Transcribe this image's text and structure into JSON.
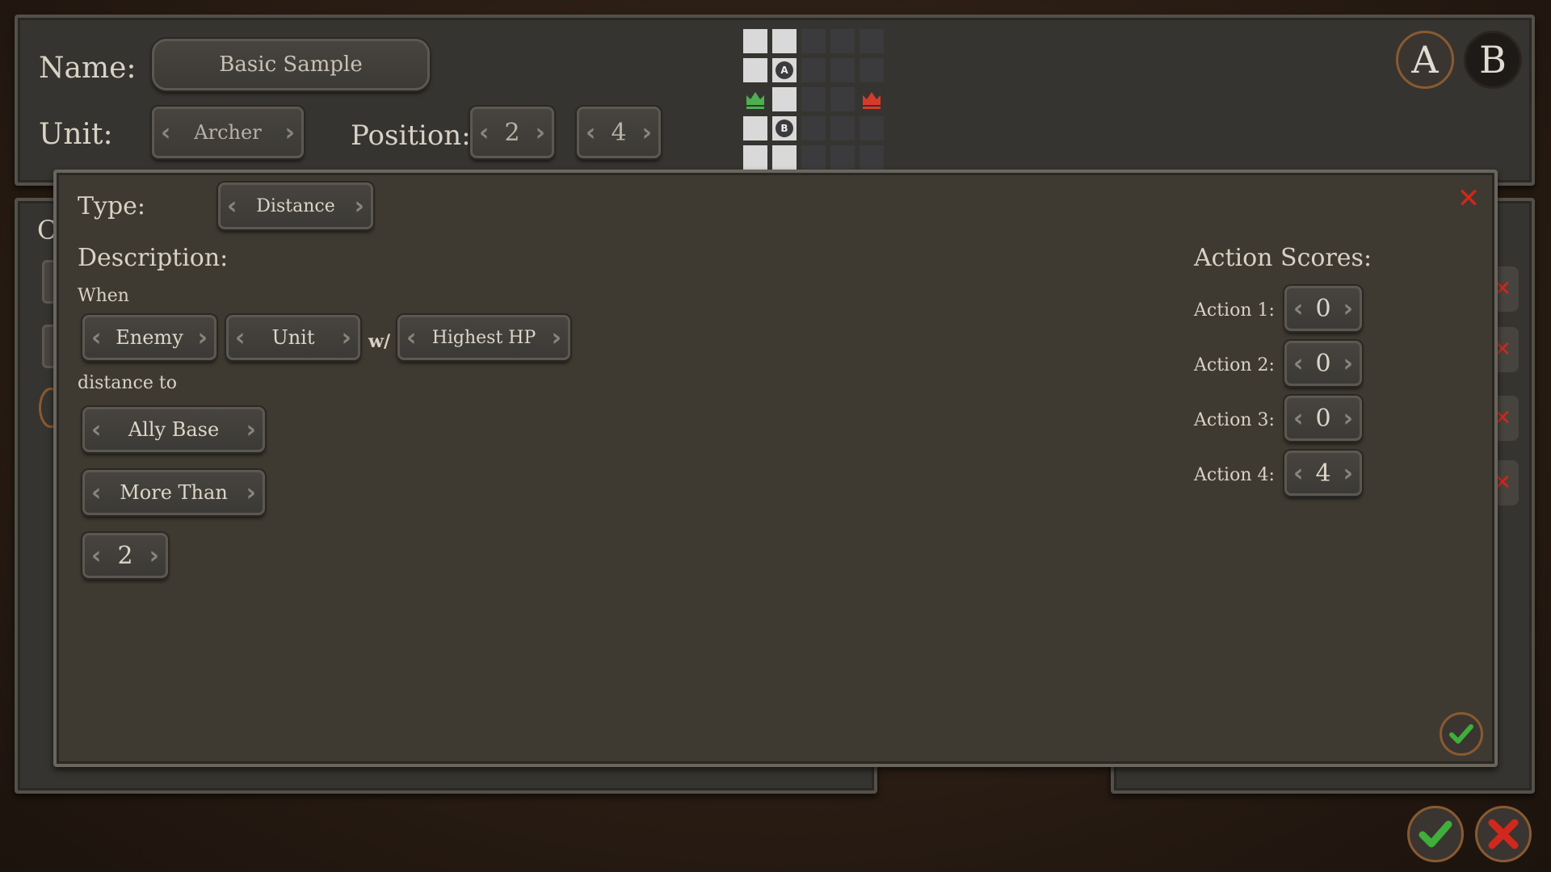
{
  "header": {
    "name_label": "Name:",
    "name_value": "Basic Sample",
    "unit_label": "Unit:",
    "unit_value": "Archer",
    "position_label": "Position:",
    "position_x": "2",
    "position_y": "4",
    "team_a": "A",
    "team_b": "B"
  },
  "board": {
    "marker_a": "A",
    "marker_b": "B",
    "ally_crown_color": "#4caf50",
    "enemy_crown_color": "#d83a2a"
  },
  "modal": {
    "type_label": "Type:",
    "type_value": "Distance",
    "description_label": "Description:",
    "when_label": "When",
    "target_side": "Enemy",
    "target_kind": "Unit",
    "with_label": "w/",
    "target_filter": "Highest HP",
    "distance_to_label": "distance to",
    "reference": "Ally Base",
    "comparison": "More Than",
    "distance_value": "2",
    "action_scores_label": "Action Scores:",
    "actions": [
      {
        "label": "Action 1:",
        "value": "0"
      },
      {
        "label": "Action 2:",
        "value": "0"
      },
      {
        "label": "Action 3:",
        "value": "0"
      },
      {
        "label": "Action 4:",
        "value": "4"
      }
    ]
  },
  "colors": {
    "accept": "#3fae3a",
    "reject": "#d0281d"
  }
}
